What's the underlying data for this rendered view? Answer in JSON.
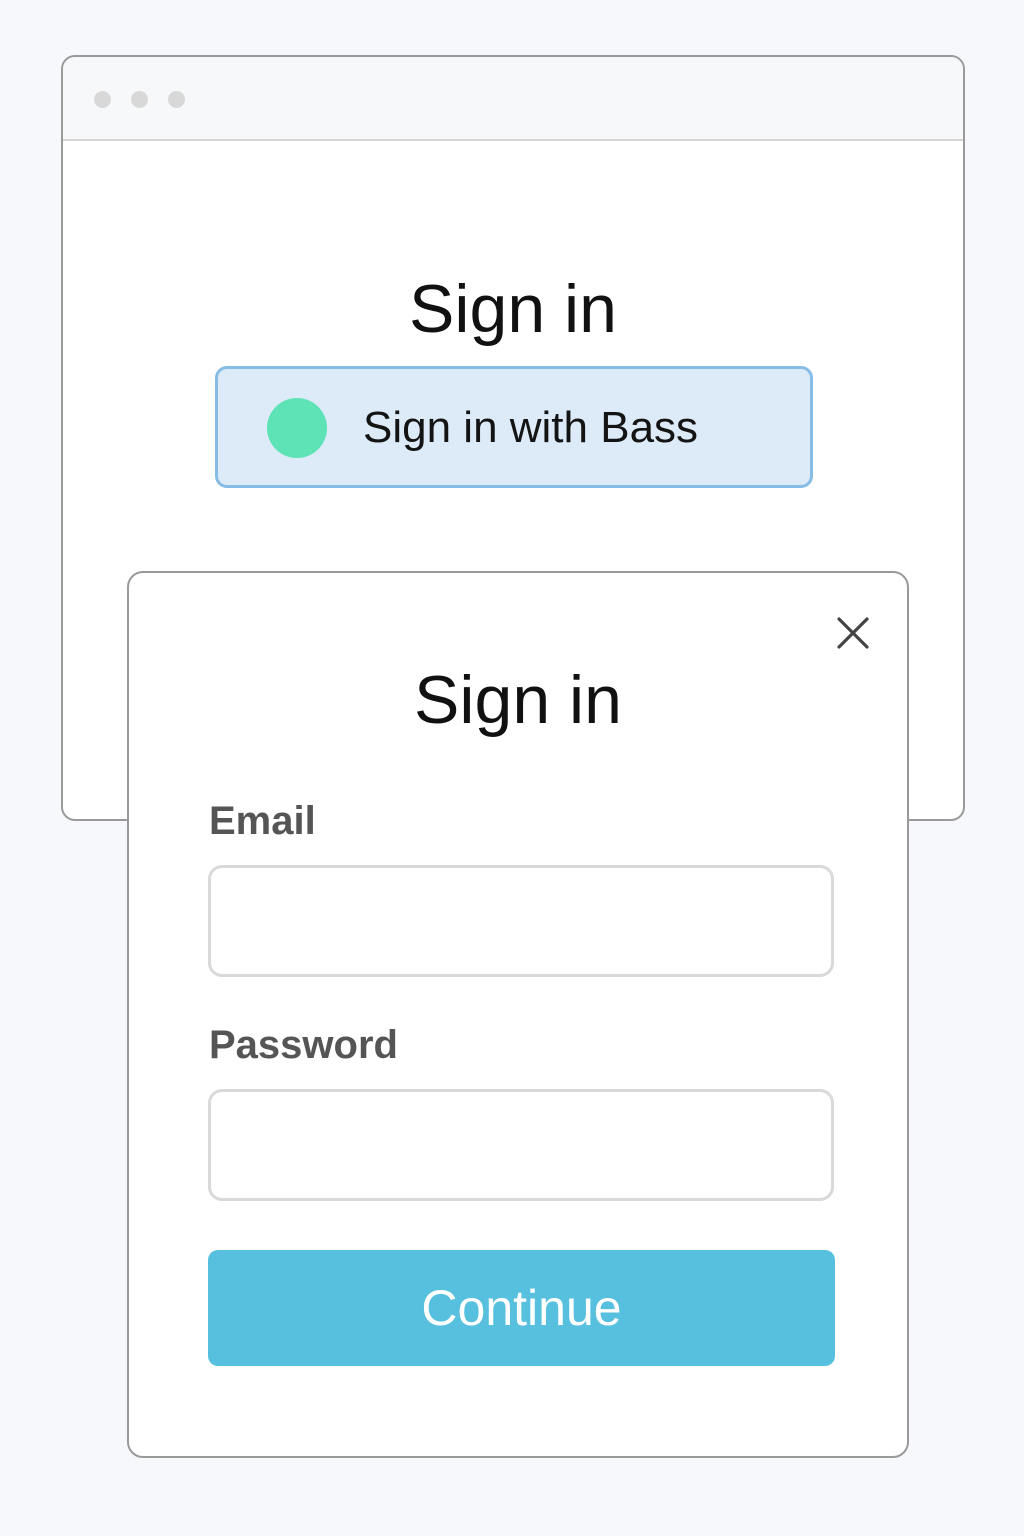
{
  "window": {
    "title": "Sign in",
    "sso_button": {
      "label": "Sign in with Bass",
      "logo_icon": "bass-logo-icon",
      "logo_color": "#5de3b5",
      "background_color": "#dcebf7",
      "border_color": "#86bde6"
    }
  },
  "dialog": {
    "title": "Sign in",
    "close_icon": "close-icon",
    "email": {
      "label": "Email",
      "value": "",
      "placeholder": ""
    },
    "password": {
      "label": "Password",
      "value": "",
      "placeholder": ""
    },
    "continue_button": {
      "label": "Continue",
      "color": "#56c0de"
    }
  }
}
